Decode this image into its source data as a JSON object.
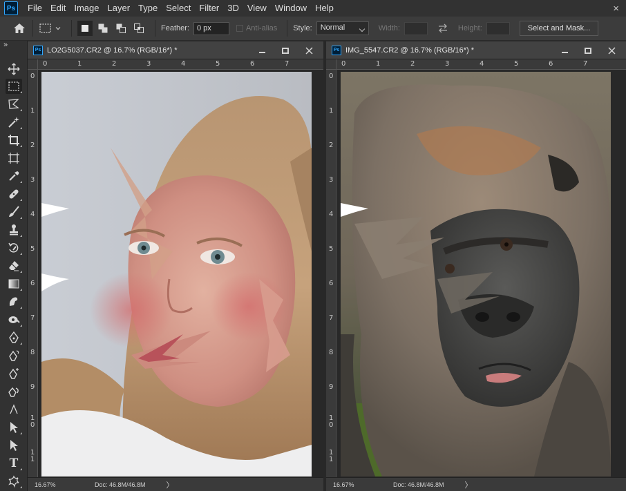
{
  "app": {
    "logo": "Ps",
    "menu": [
      "File",
      "Edit",
      "Image",
      "Layer",
      "Type",
      "Select",
      "Filter",
      "3D",
      "View",
      "Window",
      "Help"
    ],
    "close_glyph": "×"
  },
  "options_bar": {
    "feather_label": "Feather:",
    "feather_value": "0 px",
    "antialias_label": "Anti-alias",
    "style_label": "Style:",
    "style_value": "Normal",
    "width_label": "Width:",
    "height_label": "Height:",
    "select_mask_label": "Select and Mask..."
  },
  "toolbar": {
    "collapse_glyph": "»",
    "type_tool_glyph": "T"
  },
  "documents": [
    {
      "title": "LO2G5037.CR2 @ 16.7% (RGB/16*) *",
      "zoom": "16.67%",
      "doc_size": "Doc: 46.8M/46.8M",
      "status_arrow": "〉",
      "h_ruler": [
        "0",
        "1",
        "2",
        "3",
        "4",
        "5",
        "6",
        "7"
      ],
      "v_ruler": [
        "0",
        "1",
        "2",
        "3",
        "4",
        "5",
        "6",
        "7",
        "8",
        "9",
        "1 0",
        "1 1"
      ]
    },
    {
      "title": "IMG_5547.CR2 @ 16.7% (RGB/16*) *",
      "zoom": "16.67%",
      "doc_size": "Doc: 46.8M/46.8M",
      "status_arrow": "〉",
      "h_ruler": [
        "0",
        "1",
        "2",
        "3",
        "4",
        "5",
        "6",
        "7"
      ],
      "v_ruler": [
        "0",
        "1",
        "2",
        "3",
        "4",
        "5",
        "6",
        "7",
        "8",
        "9",
        "1 0",
        "1 1"
      ]
    }
  ]
}
